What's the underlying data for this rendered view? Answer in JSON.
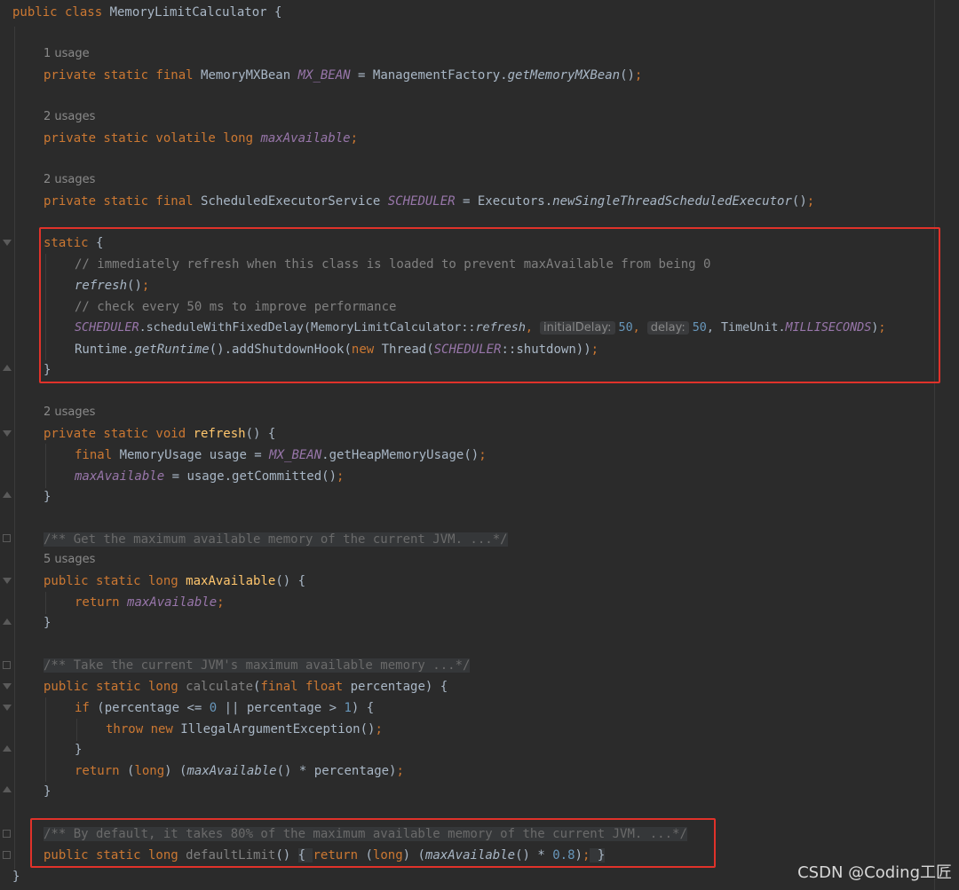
{
  "editor": {
    "language": "Java",
    "colors": {
      "background": "#2b2b2b",
      "keyword": "#cc7832",
      "field": "#9876aa",
      "method": "#ffc66d",
      "comment": "#808080",
      "number": "#6897bb",
      "highlight_box": "#e0322a"
    },
    "usages": {
      "mx_bean": "1 usage",
      "max_available": "2 usages",
      "scheduler": "2 usages",
      "refresh": "2 usages",
      "max_available_method": "5 usages"
    },
    "code": {
      "class_decl": {
        "kw": "public class ",
        "name": "MemoryLimitCalculator",
        "brace": " {"
      },
      "mx_bean_line": {
        "kw": "private static final ",
        "type": "MemoryMXBean ",
        "field": "MX_BEAN",
        "eq": " = ManagementFactory.",
        "call": "getMemoryMXBean",
        "tail": "()",
        "semi": ";"
      },
      "max_available_line": {
        "kw": "private static volatile long ",
        "field": "maxAvailable",
        "semi": ";"
      },
      "scheduler_line": {
        "kw": "private static final ",
        "type": "ScheduledExecutorService ",
        "field": "SCHEDULER",
        "eq": " = Executors.",
        "call": "newSingleThreadScheduledExecutor",
        "tail": "()",
        "semi": ";"
      },
      "static_open": {
        "kw": "static",
        "brace": " {"
      },
      "comment1": "// immediately refresh when this class is loaded to prevent maxAvailable from being 0",
      "refresh_call": {
        "call": "refresh",
        "tail": "()",
        "semi": ";"
      },
      "comment2": "// check every 50 ms to improve performance",
      "schedule_line": {
        "field": "SCHEDULER",
        "mid": ".scheduleWithFixedDelay(MemoryLimitCalculator::",
        "ref": "refresh",
        "comma1": ", ",
        "hint1": "initialDelay:",
        "num1": "50",
        "comma2": ", ",
        "hint2": "delay:",
        "num2": "50",
        "unit": ", TimeUnit.",
        "const": "MILLISECONDS",
        "close": ")",
        "semi": ";"
      },
      "hook_line": {
        "a": "Runtime.",
        "b": "getRuntime",
        "c": "().addShutdownHook(",
        "kw": "new",
        "d": " Thread(",
        "field": "SCHEDULER",
        "e": "::shutdown))",
        "semi": ";"
      },
      "close_brace": "}",
      "refresh_decl": {
        "kw": "private static void ",
        "fn": "refresh",
        "tail": "() {"
      },
      "usage_line": {
        "kw": "final ",
        "a": "MemoryUsage usage = ",
        "field": "MX_BEAN",
        "b": ".getHeapMemoryUsage()",
        "semi": ";"
      },
      "assign_line": {
        "field": "maxAvailable",
        "a": " = usage.getCommitted()",
        "semi": ";"
      },
      "doc1": "/** Get the maximum available memory of the current JVM. ...*/",
      "max_decl": {
        "kw": "public static long ",
        "fn": "maxAvailable",
        "tail": "() {"
      },
      "return_max": {
        "kw": "return ",
        "field": "maxAvailable",
        "semi": ";"
      },
      "doc2": "/** Take the current JVM's maximum available memory ...*/",
      "calc_decl": {
        "kw": "public static long ",
        "fn": "calculate",
        "a": "(",
        "kw2": "final float ",
        "b": "percentage) {"
      },
      "if_line": {
        "kw": "if ",
        "a": "(percentage <= ",
        "n1": "0",
        "b": " || percentage > ",
        "n2": "1",
        "c": ") {"
      },
      "throw_line": {
        "kw": "throw new ",
        "a": "IllegalArgumentException()",
        "semi": ";"
      },
      "return_calc": {
        "kw": "return ",
        "a": "(",
        "kw2": "long",
        "b": ") (",
        "call": "maxAvailable",
        "c": "() * percentage)",
        "semi": ";"
      },
      "doc3": "/** By default, it takes 80% of the maximum available memory of the current JVM. ...*/",
      "default_decl": {
        "kw": "public static long ",
        "fn": "defaultLimit",
        "a": "() ",
        "b": "{ ",
        "kw2": "return ",
        "c": "(",
        "kw3": "long",
        "d": ") (",
        "call": "maxAvailable",
        "e": "() * ",
        "num": "0.8",
        "f": ")",
        "semi": ";",
        "g": " }"
      }
    }
  },
  "watermark": "CSDN @Coding工匠"
}
